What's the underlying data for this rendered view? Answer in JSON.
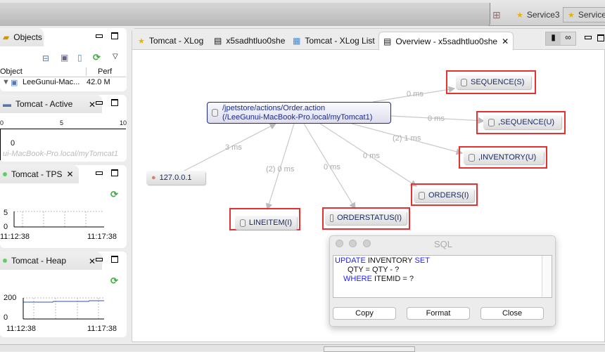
{
  "top": {
    "services": [
      "Service3",
      "Service"
    ]
  },
  "objects": {
    "title": "Objects",
    "columns": [
      "Object",
      "Perf"
    ],
    "row": {
      "name": "LeeGunui-Mac...",
      "perf": "42.0 M"
    }
  },
  "active": {
    "title": "Tomcat - Active",
    "ticks": [
      "0",
      "5",
      "10"
    ],
    "value": "0",
    "host": "ui-MacBook-Pro.local/myTomcat1"
  },
  "tps": {
    "title": "Tomcat - TPS",
    "y_ticks": [
      "5",
      "0"
    ],
    "x_ticks": [
      "11:12:38",
      "11:17:38"
    ]
  },
  "heap": {
    "title": "Tomcat - Heap",
    "y_ticks": [
      "200",
      "0"
    ],
    "x_ticks": [
      "11:12:38",
      "11:17:38"
    ],
    "series_level": 170
  },
  "tabs": [
    "Tomcat - XLog",
    "x5sadhtluo0she",
    "Tomcat - XLog List",
    "Overview - x5sadhtluo0she"
  ],
  "graph": {
    "main_node": {
      "line1": "/jpetstore/actions/Order.action",
      "line2": "(/LeeGunui-MacBook-Pro.local/myTomcat1)"
    },
    "client": "127.0.0.1",
    "nodes": [
      "SEQUENCE(S)",
      ",SEQUENCE(U)",
      ",INVENTORY(U)",
      "ORDERS(I)",
      "ORDERSTATUS(I)",
      "LINEITEM(I)"
    ],
    "edges": [
      "0 ms",
      "0 ms",
      "(2) 1 ms",
      "0 ms",
      "0 ms",
      "(2) 0 ms",
      "3 ms"
    ],
    "highlight_color": "#e83030"
  },
  "sql": {
    "title": "SQL",
    "line1_kw1": "UPDATE",
    "line1_mid": " INVENTORY ",
    "line1_kw2": "SET",
    "line2": "QTY = QTY - ?",
    "line3_kw": "WHERE",
    "line3_rest": " ITEMID = ?",
    "copy": "Copy",
    "format": "Format",
    "close": "Close"
  }
}
